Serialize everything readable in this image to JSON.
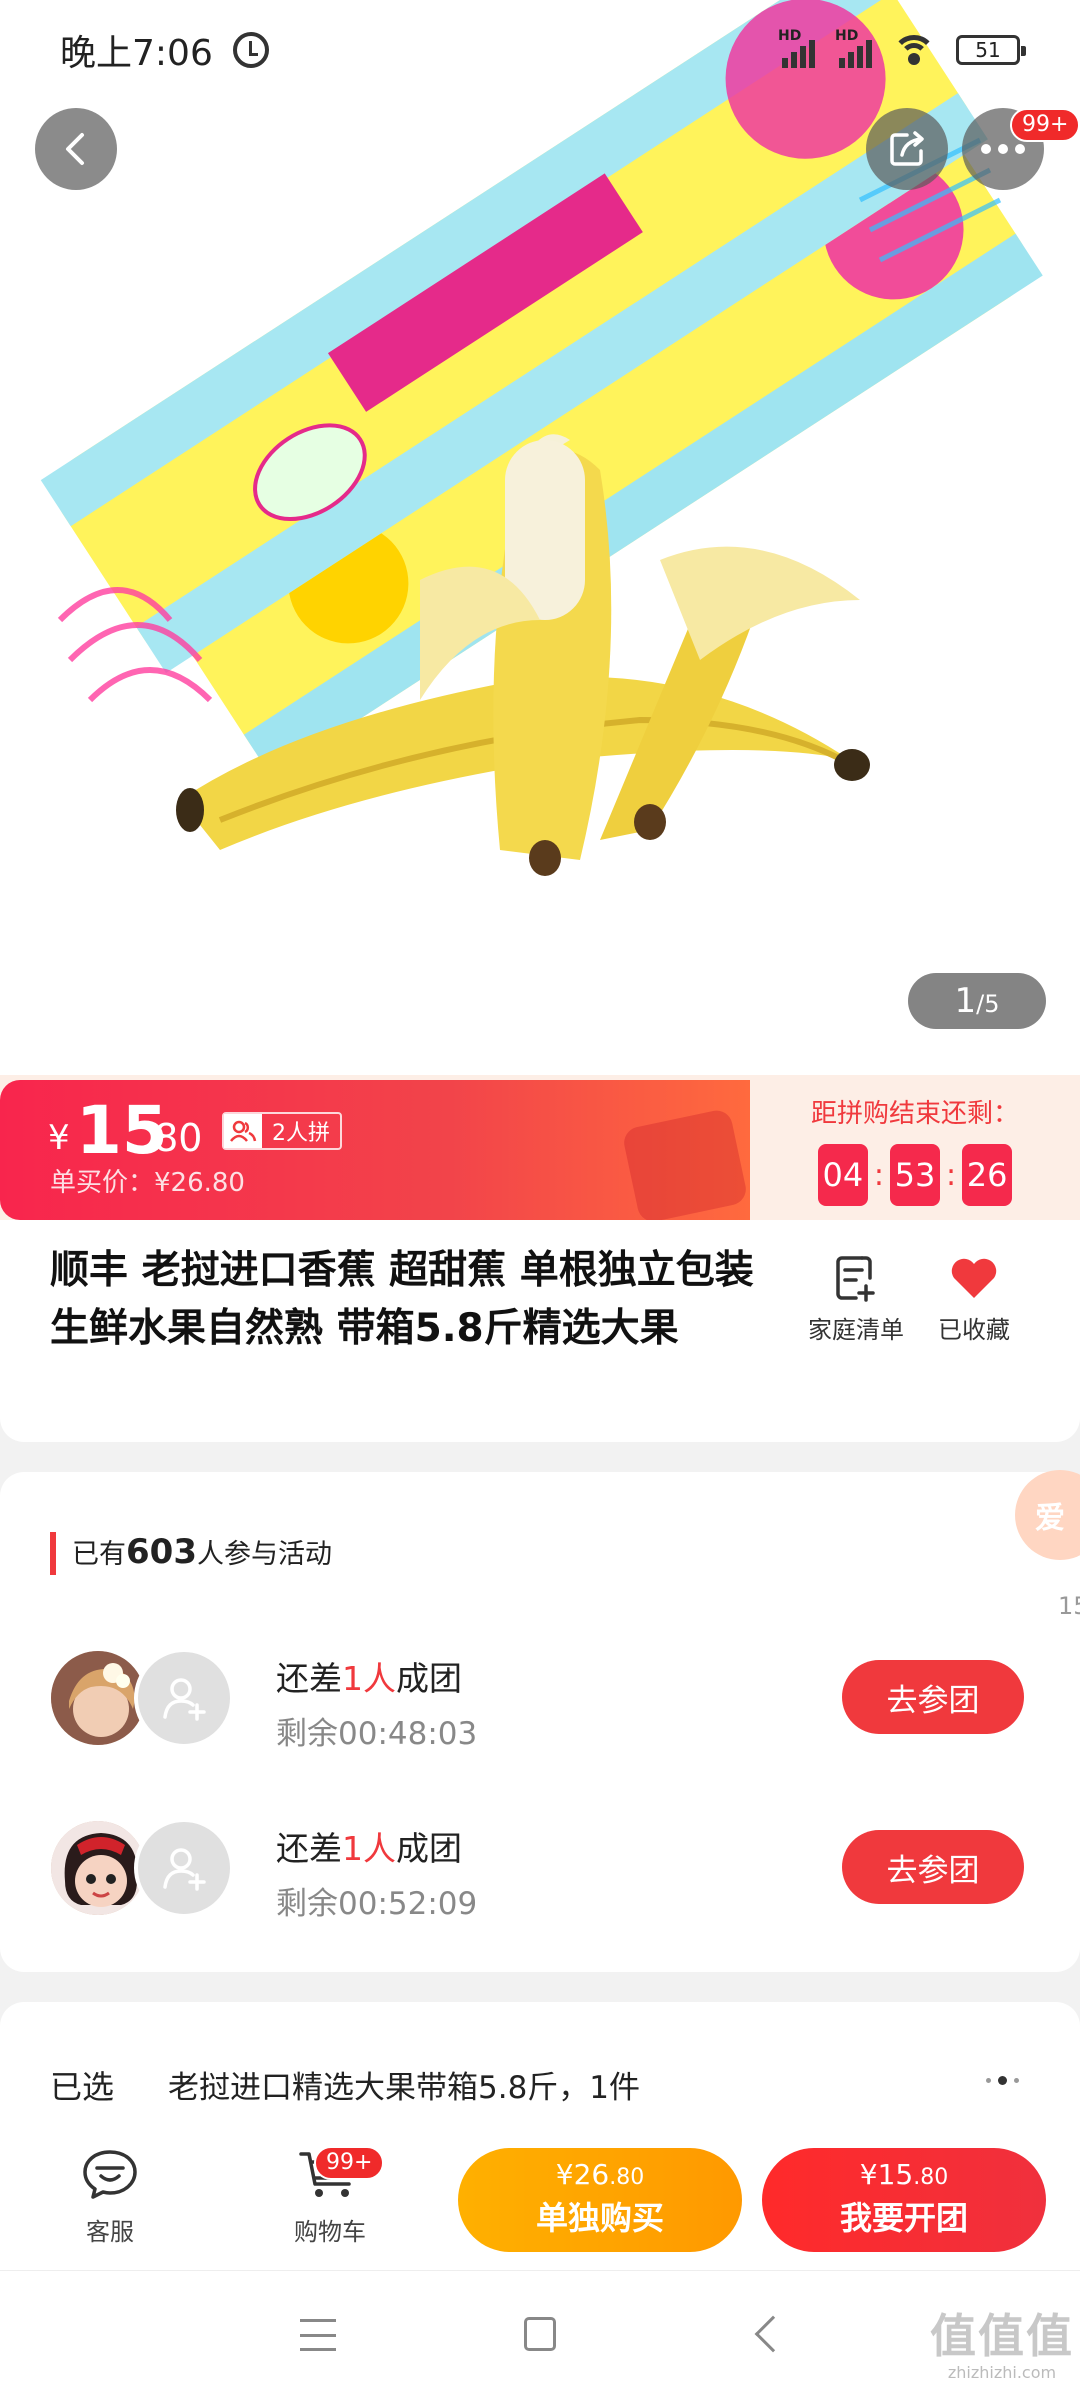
{
  "status_bar": {
    "time": "晚上7:06",
    "hd1": "HD",
    "hd2": "HD",
    "battery": "51"
  },
  "header": {
    "more_badge": "99+"
  },
  "gallery": {
    "current": "1",
    "total": "/5"
  },
  "price": {
    "currency": "¥",
    "integer": "15",
    "decimal": ".80",
    "group_tag": "2人拼",
    "original": "单买价：¥26.80"
  },
  "countdown": {
    "label": "距拼购结束还剩：",
    "hours": "04",
    "minutes": "53",
    "seconds": "26",
    "sep": ":"
  },
  "product": {
    "title": "顺丰 老挝进口香蕉 超甜蕉 单根独立包装 生鲜水果自然熟 带箱5.8斤精选大果",
    "family_list": "家庭清单",
    "favorited": "已收藏"
  },
  "groups": {
    "header_prefix": "已有",
    "count": "603",
    "header_suffix": "人参与活动",
    "items": [
      {
        "need_prefix": "还差",
        "need_num": "1人",
        "need_suffix": "成团",
        "remaining": "剩余00:48:03",
        "button": "去参团"
      },
      {
        "need_prefix": "还差",
        "need_num": "1人",
        "need_suffix": "成团",
        "remaining": "剩余00:52:09",
        "button": "去参团"
      }
    ]
  },
  "float_widget": {
    "label": "爱",
    "number": "15"
  },
  "selected": {
    "label": "已选",
    "value": "老挝进口精选大果带箱5.8斤，1件"
  },
  "bottom_bar": {
    "service": "客服",
    "cart": "购物车",
    "cart_badge": "99+",
    "solo_price_main": "¥26",
    "solo_price_dec": ".80",
    "solo_label": "单独购买",
    "group_price_main": "¥15",
    "group_price_dec": ".80",
    "group_label": "我要开团"
  },
  "watermark": {
    "main": "值值值",
    "sub": "zhizhizhi.com"
  },
  "colors": {
    "accent_red": "#f0393d",
    "orange": "#ffa800",
    "price_gradient_start": "#f8254d"
  }
}
